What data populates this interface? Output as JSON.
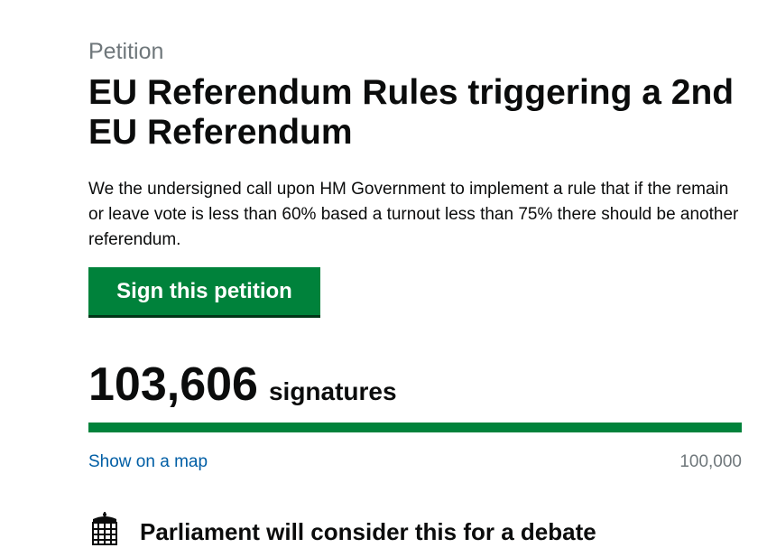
{
  "petition": {
    "kicker": "Petition",
    "title": "EU Referendum Rules triggering a 2nd EU Referendum",
    "description": "We the undersigned call upon HM Government to implement a rule that if the remain or leave vote is less than 60% based a turnout less than 75% there should be another referendum.",
    "sign_button_label": "Sign this petition"
  },
  "signatures": {
    "count": "103,606",
    "label": "signatures",
    "progress_percent": 100,
    "progress_color": "#00823b",
    "map_link_label": "Show on a map",
    "threshold": "100,000"
  },
  "debate": {
    "icon": "portcullis-icon",
    "heading": "Parliament will consider this for a debate"
  },
  "colors": {
    "button_green": "#00823b",
    "link_blue": "#005ea5",
    "secondary_grey": "#6f777b"
  }
}
